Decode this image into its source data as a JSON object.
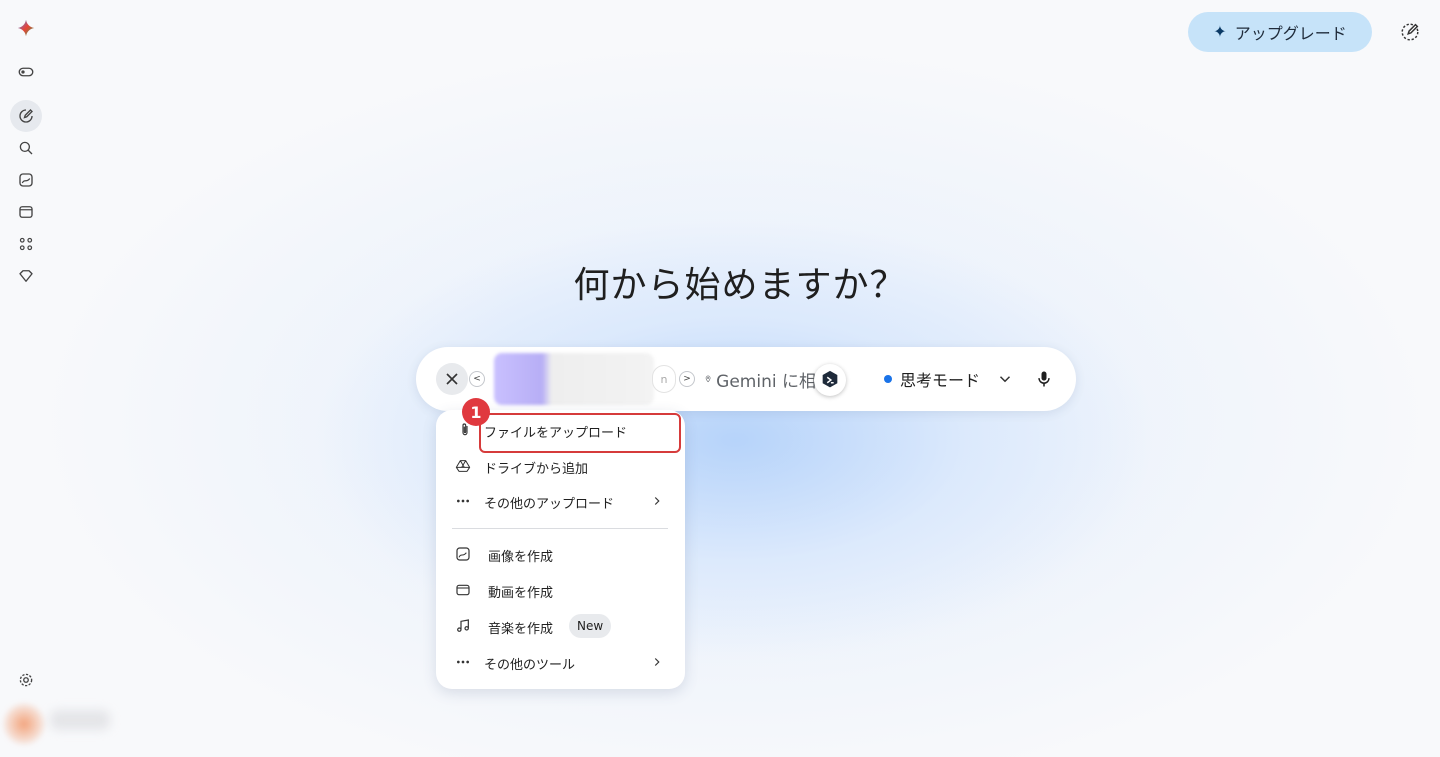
{
  "headline": "何から始めますか？",
  "header": {
    "upgrade_label": "アップグレード"
  },
  "input_bar": {
    "placeholder_text": "Gemini に相",
    "thumb_end_text": "n",
    "nav_prev": "<",
    "nav_next": ">",
    "mode_label": "思考モード"
  },
  "menu": {
    "upload_file": "ファイルをアップロード",
    "add_from_drive": "ドライブから追加",
    "more_uploads": "その他のアップロード",
    "create_image": "画像を作成",
    "create_video": "動画を作成",
    "create_music": "音楽を作成",
    "new_badge": "New",
    "more_tools": "その他のツール"
  },
  "annotation": {
    "step_number": "1",
    "color": "#d63b3b"
  },
  "colors": {
    "accent": "#1a73e8",
    "upgrade_bg": "#c6e3f9"
  }
}
